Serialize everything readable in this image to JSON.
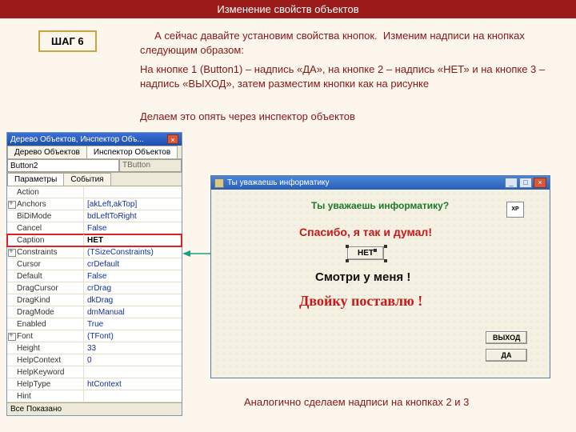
{
  "header": {
    "title": "Изменение свойств объектов"
  },
  "step": {
    "label": "ШАГ 6"
  },
  "text": {
    "p1": "     А сейчас давайте установим свойства кнопок.  Изменим надписи на кнопках следующим образом:",
    "p2": "На кнопке 1 (Button1) – надпись «ДА», на кнопке 2 – надпись «НЕТ» и на кнопке 3 – надпись «ВЫХОД», затем разместим кнопки как на рисунке",
    "p3": "Делаем это опять через инспектор объектов",
    "footer": "Аналогично сделаем надписи на кнопках 2 и 3"
  },
  "inspector": {
    "title": "Дерево Объектов, Инспектор Объ...",
    "top_tabs": {
      "t1": "Дерево Объектов",
      "t2": "Инспектор Объектов"
    },
    "combo": {
      "name": "Button2",
      "type": "TButton"
    },
    "sub_tabs": {
      "t1": "Параметры",
      "t2": "События"
    },
    "rows": [
      {
        "n": "Action",
        "v": "",
        "exp": false
      },
      {
        "n": "Anchors",
        "v": "[akLeft,akTop]",
        "exp": true
      },
      {
        "n": "BiDiMode",
        "v": "bdLeftToRight",
        "exp": false
      },
      {
        "n": "Cancel",
        "v": "False",
        "exp": false
      },
      {
        "n": "Caption",
        "v": "НЕТ",
        "exp": false,
        "hl": true
      },
      {
        "n": "Constraints",
        "v": "(TSizeConstraints)",
        "exp": true
      },
      {
        "n": "Cursor",
        "v": "crDefault",
        "exp": false
      },
      {
        "n": "Default",
        "v": "False",
        "exp": false
      },
      {
        "n": "DragCursor",
        "v": "crDrag",
        "exp": false
      },
      {
        "n": "DragKind",
        "v": "dkDrag",
        "exp": false
      },
      {
        "n": "DragMode",
        "v": "dmManual",
        "exp": false
      },
      {
        "n": "Enabled",
        "v": "True",
        "exp": false
      },
      {
        "n": "Font",
        "v": "(TFont)",
        "exp": true
      },
      {
        "n": "Height",
        "v": "33",
        "exp": false
      },
      {
        "n": "HelpContext",
        "v": "0",
        "exp": false
      },
      {
        "n": "HelpKeyword",
        "v": "",
        "exp": false
      },
      {
        "n": "HelpType",
        "v": "htContext",
        "exp": false
      },
      {
        "n": "Hint",
        "v": "",
        "exp": false
      }
    ],
    "bottom": "Все Показано"
  },
  "form": {
    "title": "Ты уважаешь информатику",
    "question": "Ты уважаешь информатику?",
    "thanks": "Спасибо, я так и думал!",
    "net": "НЕТ",
    "watch": "Смотри у меня !",
    "dvoyku": "Двойку поставлю !",
    "exit": "ВЫХОД",
    "da": "ДА",
    "xp": "XP"
  }
}
